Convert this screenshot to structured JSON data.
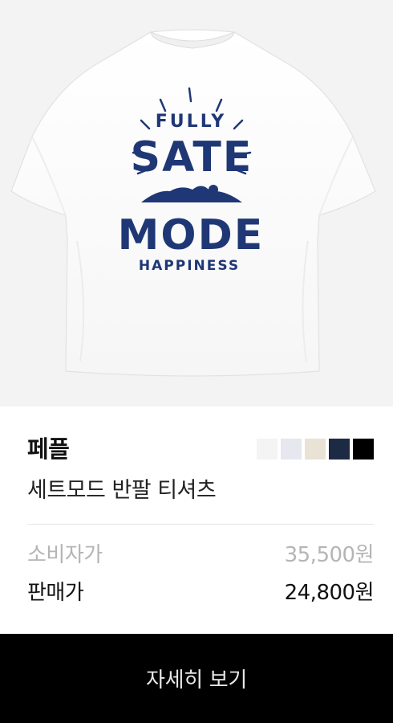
{
  "product": {
    "brand": "페플",
    "name": "세트모드 반팔 티셔츠",
    "print_text": {
      "line1": "FULLY",
      "line2": "SATE",
      "line3": "MODE",
      "line4": "HAPPINESS"
    },
    "colors": [
      "#f4f4f4",
      "#e6e7ef",
      "#e9e3d6",
      "#1d2a44",
      "#000000"
    ]
  },
  "pricing": {
    "msrp_label": "소비자가",
    "msrp_value": "35,500원",
    "sale_label": "판매가",
    "sale_value": "24,800원"
  },
  "cta": {
    "label": "자세히 보기"
  }
}
